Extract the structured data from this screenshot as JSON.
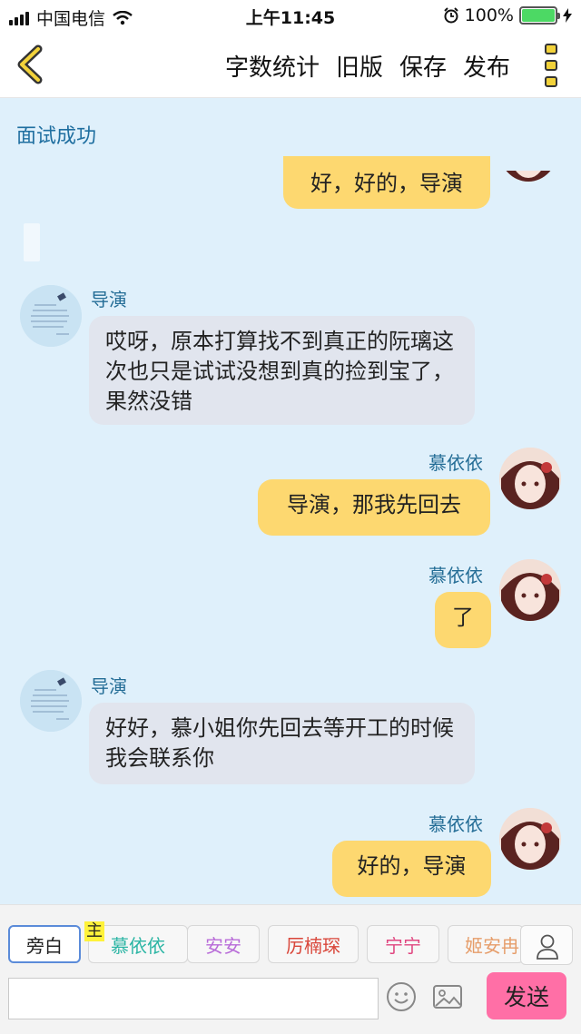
{
  "status_bar": {
    "carrier": "中国电信",
    "time": "上午11:45",
    "battery": "100%"
  },
  "nav": {
    "actions": [
      "字数统计",
      "旧版",
      "保存",
      "发布"
    ]
  },
  "chat": {
    "title": "面试成功",
    "messages": [
      {
        "side": "right",
        "speaker": "",
        "text": "好，好的，导演"
      },
      {
        "side": "left",
        "speaker": "导演",
        "text": "哎呀，原本打算找不到真正的阮璃这次也只是试试没想到真的捡到宝了，果然没错"
      },
      {
        "side": "right",
        "speaker": "慕依依",
        "text": "导演，那我先回去"
      },
      {
        "side": "right",
        "speaker": "慕依依",
        "text": "了"
      },
      {
        "side": "left",
        "speaker": "导演",
        "text": "好好，慕小姐你先回去等开工的时候我会联系你"
      },
      {
        "side": "right",
        "speaker": "慕依依",
        "text": "好的，导演"
      }
    ]
  },
  "composer": {
    "main_badge": "主",
    "roles": [
      {
        "label": "旁白",
        "color": "#222222"
      },
      {
        "label": "慕依依",
        "color": "#2bb5a4"
      },
      {
        "label": "安安",
        "color": "#b86bd8"
      },
      {
        "label": "厉楠琛",
        "color": "#d9463a"
      },
      {
        "label": "宁宁",
        "color": "#e0457f"
      },
      {
        "label": "姬安冉",
        "color": "#e69d6a"
      }
    ],
    "input_value": "",
    "send_label": "发送"
  }
}
